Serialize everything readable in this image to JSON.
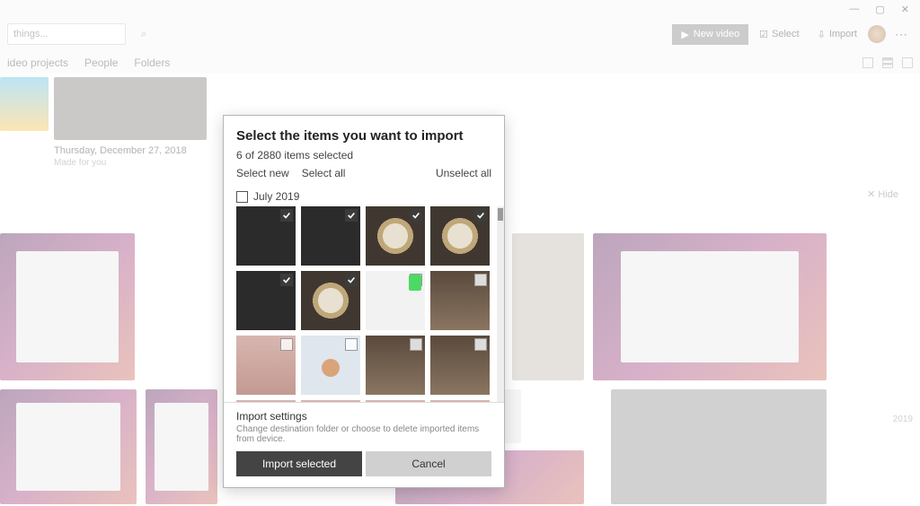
{
  "window": {
    "minimize": "—",
    "maximize": "▢",
    "close": "✕"
  },
  "toolbar": {
    "search_placeholder": "things...",
    "new_video": "New video",
    "select": "Select",
    "import": "Import"
  },
  "tabs": {
    "a": "ideo projects",
    "b": "People",
    "c": "Folders"
  },
  "album": {
    "date": "Thursday, December 27, 2018",
    "sub": "Made for you"
  },
  "hide": "Hide",
  "year": "2019",
  "modal": {
    "title": "Select the items you want to import",
    "count": "6 of 2880 items selected",
    "select_new": "Select new",
    "select_all": "Select all",
    "unselect_all": "Unselect all",
    "group": "July 2019",
    "thumbs": [
      {
        "sel": true,
        "cls": "dark"
      },
      {
        "sel": true,
        "cls": "dark"
      },
      {
        "sel": true,
        "cls": "ring"
      },
      {
        "sel": true,
        "cls": "ring"
      },
      {
        "sel": true,
        "cls": "dark"
      },
      {
        "sel": true,
        "cls": "ring"
      },
      {
        "sel": false,
        "cls": "doc"
      },
      {
        "sel": false,
        "cls": "room"
      },
      {
        "sel": false,
        "cls": "pink"
      },
      {
        "sel": false,
        "cls": "face"
      },
      {
        "sel": false,
        "cls": "room"
      },
      {
        "sel": false,
        "cls": "room"
      }
    ],
    "settings_title": "Import settings",
    "settings_sub": "Change destination folder or choose to delete imported items from device.",
    "import_btn": "Import selected",
    "cancel_btn": "Cancel"
  }
}
